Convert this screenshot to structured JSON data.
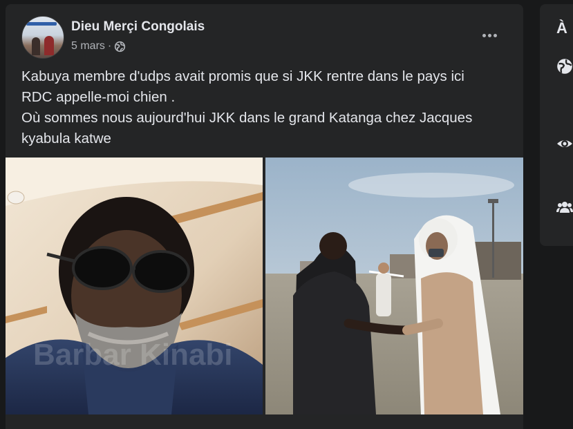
{
  "post": {
    "author": "Dieu Merçi Congolais",
    "timestamp": "5 mars",
    "separator": "·",
    "audience_icon": "globe-icon",
    "more_icon": "more-options-icon",
    "text_lines": [
      "Kabuya membre d'udps avait promis que si JKK rentre dans le pays ici",
      "RDC appelle-moi chien .",
      "Où sommes nous aujourd'hui JKK dans le grand Katanga chez Jacques",
      "kyabula katwe"
    ],
    "watermark": "Barbar Kinabi"
  },
  "right_panel": {
    "title_initial": "À",
    "icons": [
      "globe-icon",
      "eye-icon",
      "group-icon"
    ]
  }
}
